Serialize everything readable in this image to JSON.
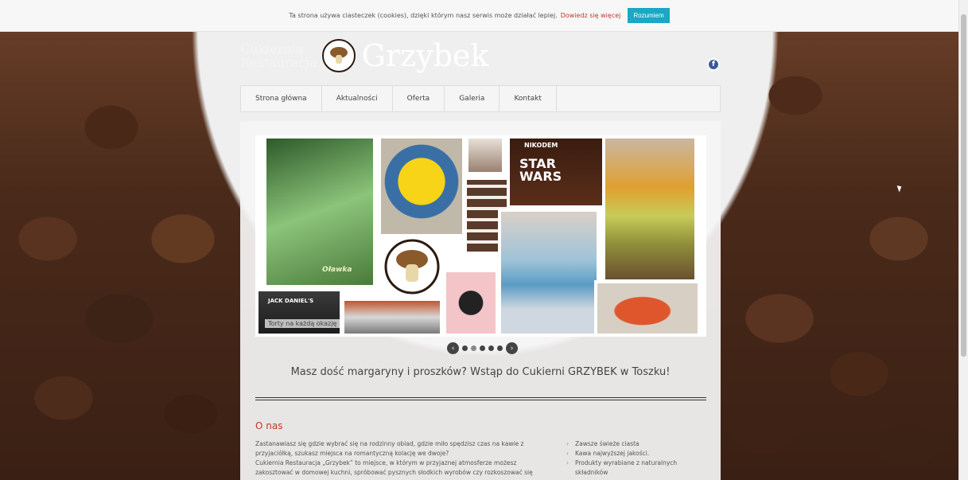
{
  "cookie_bar": {
    "text": "Ta strona używa ciasteczek (cookies), dzięki którym nasz serwis może działać lepiej.",
    "more_link": "Dowiedz się więcej",
    "accept_label": "Rozumiem"
  },
  "logo": {
    "line1": "Cukiernia",
    "line2": "Restauracja",
    "name": "Grzybek"
  },
  "social": {
    "facebook_glyph": "f"
  },
  "nav": {
    "items": [
      {
        "label": "Strona główna"
      },
      {
        "label": "Aktualności"
      },
      {
        "label": "Oferta"
      },
      {
        "label": "Galeria"
      },
      {
        "label": "Kontakt"
      }
    ]
  },
  "slider": {
    "caption": "Torty na każdą okazję",
    "tile_labels": {
      "starwars": "STAR WARS",
      "nikodem": "NIKODEM",
      "jack": "JACK DANIEL'S",
      "olawka": "Oławka"
    },
    "slides_count": 5,
    "active_index": 1
  },
  "tagline": "Masz dość margaryny i proszków? Wstąp do Cukierni GRZYBEK w Toszku!",
  "about": {
    "title": "O nas",
    "text_lines": [
      "Zastanawiasz się gdzie wybrać się na rodzinny obiad, gdzie miło spędzisz czas na kawie z",
      "przyjaciółką, szukasz miejsca na romantyczną kolację we dwoje?",
      "Cukiernia Restauracja „Grzybek” to miejsce, w którym w przyjaznej atmosferze możesz",
      "zakosztować w domowej kuchni, spróbować pysznych słodkich wyrobów czy rozkoszować się"
    ],
    "features": [
      "Zawsze świeże ciasta",
      "Kawa najwyższej jakości.",
      "Produkty wyrabiane z naturalnych składników"
    ]
  }
}
